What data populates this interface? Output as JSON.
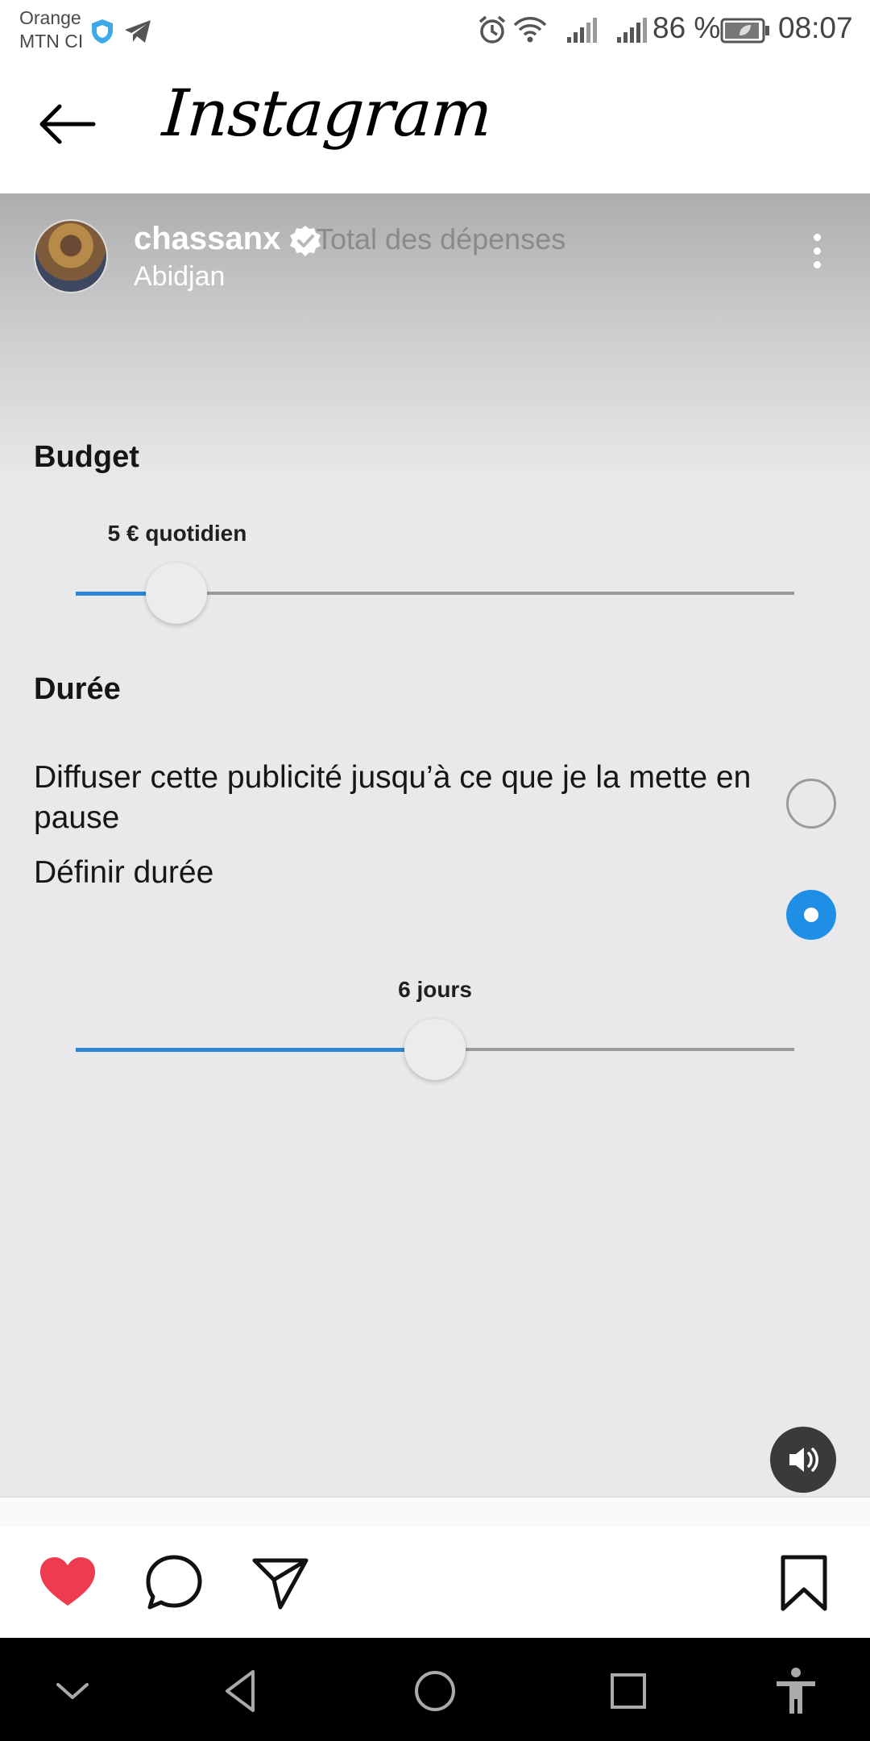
{
  "status_bar": {
    "carrier_line1": "Orange",
    "carrier_line2": "MTN CI",
    "battery_percent": "86 %",
    "time": "08:07"
  },
  "header": {
    "back_icon": "arrow-left-icon",
    "app_title": "Instagram"
  },
  "post": {
    "username": "chassanx",
    "verified_icon": "verified-badge-icon",
    "overlay_text": "Total des dépenses",
    "location": "Abidjan",
    "more_icon": "more-vertical-icon"
  },
  "budget": {
    "title": "Budget",
    "value_label": "5 € quotidien",
    "slider_fraction": 0.14
  },
  "duration": {
    "title": "Durée",
    "option_until_pause": "Diffuser cette publicité jusqu’à ce que je la mette en pause",
    "option_until_pause_selected": false,
    "option_set_duration": "Définir durée",
    "option_set_duration_selected": true,
    "value_label": "6 jours",
    "slider_fraction": 0.5
  },
  "media_controls": {
    "volume_icon": "volume-icon"
  },
  "actions": {
    "like_icon": "heart-icon",
    "like_color": "#ed3b4f",
    "comment_icon": "comment-icon",
    "share_icon": "send-icon",
    "save_icon": "bookmark-icon"
  },
  "navigation": {
    "icons": [
      "chevron-down-icon",
      "back-triangle-icon",
      "home-circle-icon",
      "recents-square-icon",
      "accessibility-icon"
    ]
  },
  "colors": {
    "accent": "#2b86d6",
    "radio_selected": "#1f8fe6"
  }
}
